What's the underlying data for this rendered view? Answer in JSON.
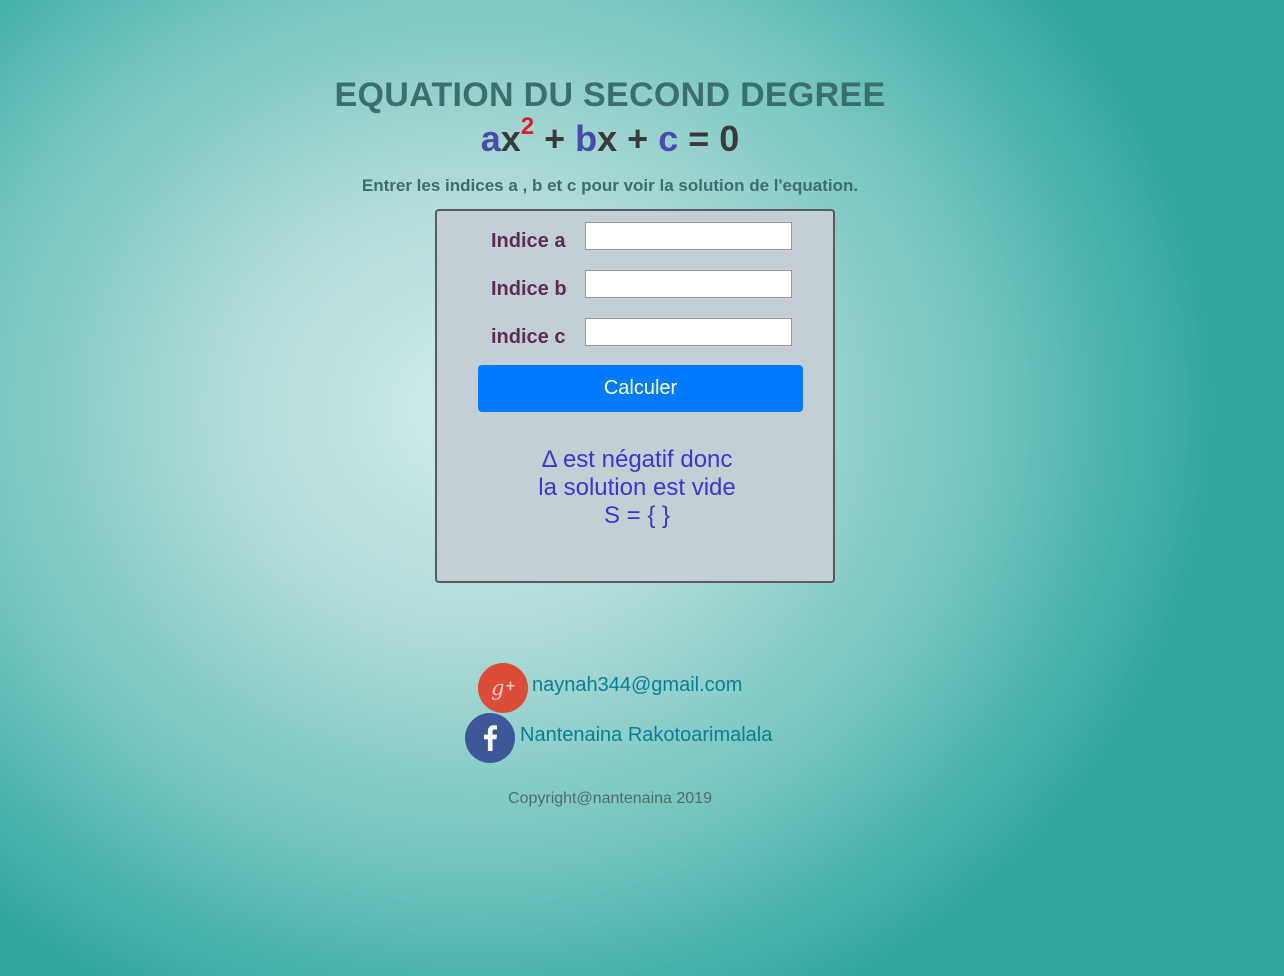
{
  "header": {
    "title": "EQUATION DU SECOND DEGREE",
    "equation": {
      "a": "a",
      "x1": "x",
      "exp": "2",
      "plus1": " + ",
      "b": "b",
      "x2": "x",
      "plus2": " + ",
      "c": "c",
      "equals": " = 0"
    },
    "instruction": "Entrer les indices a , b et c pour voir la solution de l'equation."
  },
  "form": {
    "fields": [
      {
        "label": "Indice a",
        "value": ""
      },
      {
        "label": "Indice b",
        "value": ""
      },
      {
        "label": "indice c",
        "value": ""
      }
    ],
    "button_label": "Calculer"
  },
  "result": {
    "line1": "Δ est négatif donc",
    "line2": "la solution est vide",
    "line3": "S = { }"
  },
  "contacts": {
    "email": "naynah344@gmail.com",
    "facebook": "Nantenaina Rakotoarimalala"
  },
  "footer": {
    "copyright": "Copyright@nantenaina 2019"
  },
  "colors": {
    "title": "#3b6f6c",
    "coefficient": "#4a4aa8",
    "exponent": "#e01a2c",
    "label": "#5b2d55",
    "button": "#007bff",
    "result": "#3d35d3",
    "link": "#0b7f8f",
    "gplus": "#dd4b39",
    "facebook": "#3b5998"
  },
  "icons": {
    "email": "google-plus-icon",
    "facebook": "facebook-icon"
  }
}
